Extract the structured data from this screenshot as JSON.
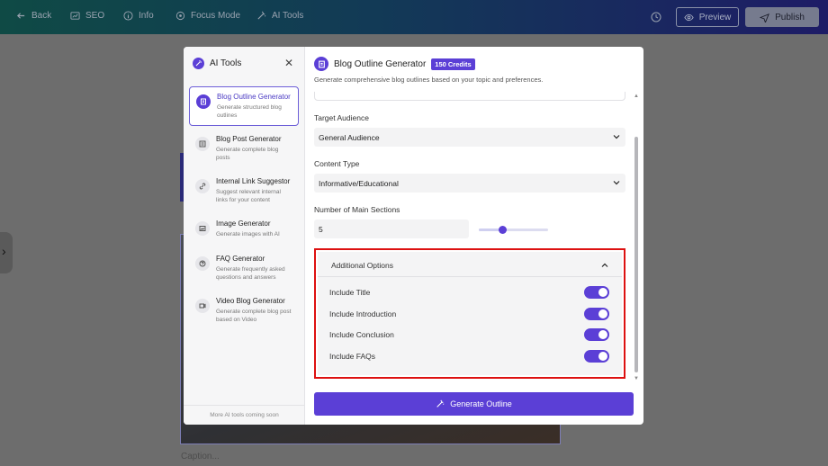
{
  "topbar": {
    "back": "Back",
    "seo": "SEO",
    "info": "Info",
    "focus_mode": "Focus Mode",
    "ai_tools": "AI Tools",
    "preview": "Preview",
    "publish": "Publish"
  },
  "editor": {
    "caption_placeholder": "Caption..."
  },
  "sidebar": {
    "title": "AI Tools",
    "tools": [
      {
        "name": "Blog Outline Generator",
        "desc": "Generate structured blog outlines"
      },
      {
        "name": "Blog Post Generator",
        "desc": "Generate complete blog posts"
      },
      {
        "name": "Internal Link Suggestor",
        "desc": "Suggest relevant internal links for your content"
      },
      {
        "name": "Image Generator",
        "desc": "Generate images with AI"
      },
      {
        "name": "FAQ Generator",
        "desc": "Generate frequently asked questions and answers"
      },
      {
        "name": "Video Blog Generator",
        "desc": "Generate complete blog post based on Video"
      }
    ],
    "footer": "More AI tools coming soon"
  },
  "main": {
    "title": "Blog Outline Generator",
    "credits": "150 Credits",
    "subtitle": "Generate comprehensive blog outlines based on your topic and preferences.",
    "target_audience_label": "Target Audience",
    "target_audience_value": "General Audience",
    "content_type_label": "Content Type",
    "content_type_value": "Informative/Educational",
    "sections_label": "Number of Main Sections",
    "sections_value": "5",
    "sections_slider_fraction": 0.33,
    "additional_options_label": "Additional Options",
    "options": [
      {
        "label": "Include Title",
        "on": true
      },
      {
        "label": "Include Introduction",
        "on": true
      },
      {
        "label": "Include Conclusion",
        "on": true
      },
      {
        "label": "Include FAQs",
        "on": true
      }
    ],
    "generate_button": "Generate Outline"
  },
  "colors": {
    "accent": "#5b3fd6",
    "highlight_border": "#dd1111"
  }
}
